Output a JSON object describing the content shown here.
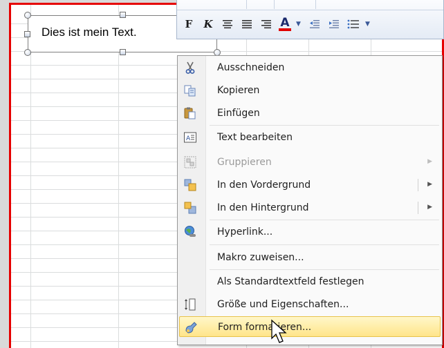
{
  "textbox": {
    "text": "Dies ist mein Text."
  },
  "mini_toolbar": {
    "bold_label": "F",
    "italic_label": "K",
    "font_color_label": "A",
    "font_color_hex": "#e00000"
  },
  "context_menu": {
    "items": [
      {
        "label": "Ausschneiden",
        "icon": "scissors-icon",
        "enabled": true
      },
      {
        "label": "Kopieren",
        "icon": "copy-icon",
        "enabled": true
      },
      {
        "label": "Einfügen",
        "icon": "paste-icon",
        "enabled": true
      },
      {
        "label": "Text bearbeiten",
        "icon": "edit-text-icon",
        "enabled": true
      },
      {
        "label": "Gruppieren",
        "icon": "group-icon",
        "enabled": false,
        "submenu": true
      },
      {
        "label": "In den Vordergrund",
        "icon": "bring-to-front-icon",
        "enabled": true,
        "submenu": true
      },
      {
        "label": "In den Hintergrund",
        "icon": "send-to-back-icon",
        "enabled": true,
        "submenu": true
      },
      {
        "label": "Hyperlink...",
        "icon": "hyperlink-icon",
        "enabled": true
      },
      {
        "label": "Makro zuweisen...",
        "enabled": true
      },
      {
        "label": "Als Standardtextfeld festlegen",
        "enabled": true
      },
      {
        "label": "Größe und Eigenschaften...",
        "icon": "size-properties-icon",
        "enabled": true
      },
      {
        "label": "Form formatieren...",
        "icon": "format-shape-icon",
        "enabled": true,
        "highlighted": true
      }
    ]
  },
  "colors": {
    "selection_frame": "#e60000",
    "menu_highlight": "#ffe58a"
  }
}
